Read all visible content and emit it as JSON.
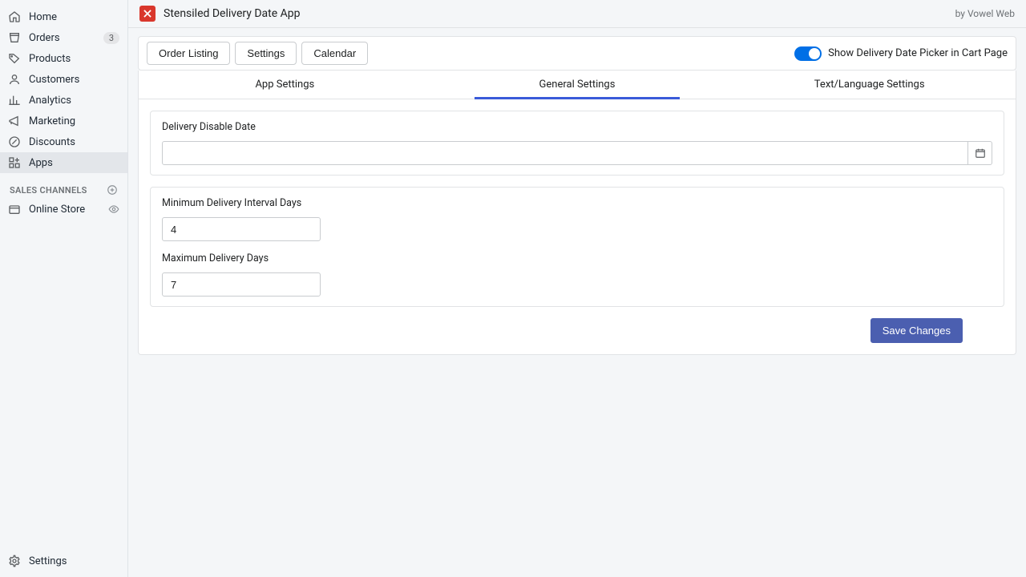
{
  "sidebar": {
    "items": [
      {
        "label": "Home"
      },
      {
        "label": "Orders",
        "badge": "3"
      },
      {
        "label": "Products"
      },
      {
        "label": "Customers"
      },
      {
        "label": "Analytics"
      },
      {
        "label": "Marketing"
      },
      {
        "label": "Discounts"
      },
      {
        "label": "Apps"
      }
    ],
    "section_label": "SALES CHANNELS",
    "channel": {
      "label": "Online Store"
    },
    "settings_label": "Settings"
  },
  "header": {
    "title": "Stensiled Delivery Date App",
    "byline": "by Vowel Web"
  },
  "toolbar": {
    "order_listing": "Order Listing",
    "settings": "Settings",
    "calendar": "Calendar",
    "toggle_label": "Show Delivery Date Picker in Cart Page",
    "toggle_on": true
  },
  "tabs": {
    "app": "App Settings",
    "general": "General Settings",
    "text": "Text/Language Settings"
  },
  "form": {
    "disable_date_label": "Delivery Disable Date",
    "disable_date_value": "",
    "min_label": "Minimum Delivery Interval Days",
    "min_value": "4",
    "max_label": "Maximum Delivery Days",
    "max_value": "7",
    "save_label": "Save Changes"
  }
}
